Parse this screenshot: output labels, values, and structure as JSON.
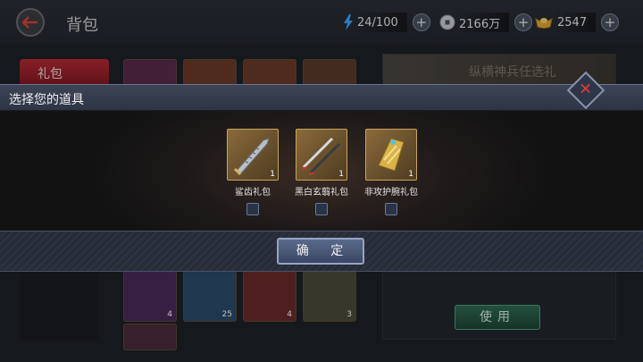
{
  "header": {
    "title": "背包",
    "resources": [
      {
        "icon": "energy-icon",
        "value": "24/100"
      },
      {
        "icon": "silver-coin-icon",
        "value": "2166万"
      },
      {
        "icon": "gold-ingot-icon",
        "value": "2547"
      }
    ]
  },
  "background": {
    "left_tab": "礼包",
    "right_panel_title": "纵横神兵任选礼",
    "use_button": "使用",
    "slot_counts": [
      "4",
      "25",
      "4",
      "3"
    ]
  },
  "dialog": {
    "title": "选择您的道具",
    "confirm_label": "确 定",
    "items": [
      {
        "name": "鲨齿礼包",
        "count": "1",
        "icon": "serrated-sword-icon"
      },
      {
        "name": "黑白玄翦礼包",
        "count": "1",
        "icon": "twin-swords-icon"
      },
      {
        "name": "非攻护腕礼包",
        "count": "1",
        "icon": "gauntlet-icon"
      }
    ]
  },
  "colors": {
    "accent_red": "#b72a36",
    "dialog_blue": "#3c4456",
    "item_gold": "#c9a45a",
    "use_green": "#2f6b52"
  }
}
